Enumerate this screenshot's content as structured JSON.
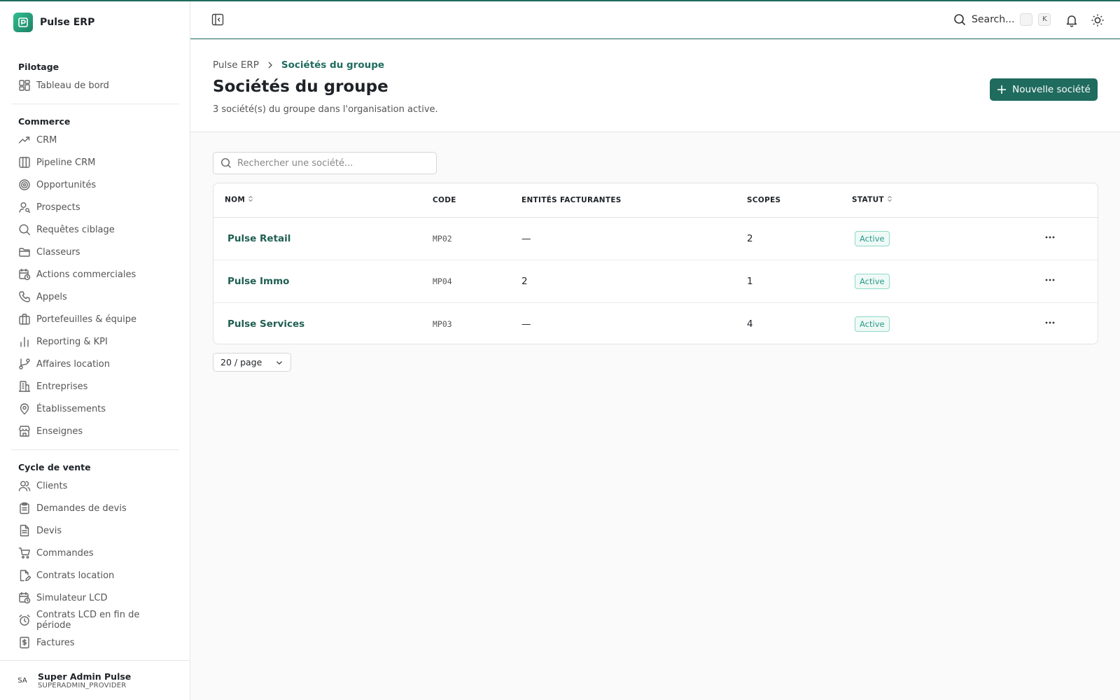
{
  "app": {
    "name": "Pulse ERP"
  },
  "topbar": {
    "search_label": "Search...",
    "shortcut_key": "K"
  },
  "sidebar": {
    "sections": [
      {
        "title": "Pilotage",
        "items": [
          {
            "label": "Tableau de bord",
            "icon": "dashboard-icon"
          }
        ]
      },
      {
        "title": "Commerce",
        "items": [
          {
            "label": "CRM",
            "icon": "trending-up-icon"
          },
          {
            "label": "Pipeline CRM",
            "icon": "kanban-icon"
          },
          {
            "label": "Opportunités",
            "icon": "target-icon"
          },
          {
            "label": "Prospects",
            "icon": "user-search-icon"
          },
          {
            "label": "Requêtes ciblage",
            "icon": "search-icon"
          },
          {
            "label": "Classeurs",
            "icon": "folder-icon"
          },
          {
            "label": "Actions commerciales",
            "icon": "calendar-clock-icon"
          },
          {
            "label": "Appels",
            "icon": "phone-icon"
          },
          {
            "label": "Portefeuilles & équipe",
            "icon": "briefcase-icon"
          },
          {
            "label": "Reporting & KPI",
            "icon": "bar-chart-icon"
          },
          {
            "label": "Affaires location",
            "icon": "git-branch-icon"
          },
          {
            "label": "Entreprises",
            "icon": "building-icon"
          },
          {
            "label": "Établissements",
            "icon": "map-pin-icon"
          },
          {
            "label": "Enseignes",
            "icon": "store-icon"
          }
        ]
      },
      {
        "title": "Cycle de vente",
        "items": [
          {
            "label": "Clients",
            "icon": "users-icon"
          },
          {
            "label": "Demandes de devis",
            "icon": "clipboard-icon"
          },
          {
            "label": "Devis",
            "icon": "file-text-icon"
          },
          {
            "label": "Commandes",
            "icon": "cart-icon"
          },
          {
            "label": "Contrats location",
            "icon": "file-edit-icon"
          },
          {
            "label": "Simulateur LCD",
            "icon": "calendar-clock-icon"
          },
          {
            "label": "Contrats LCD en fin de période",
            "icon": "alarm-clock-icon"
          },
          {
            "label": "Factures",
            "icon": "invoice-dollar-icon"
          }
        ]
      }
    ],
    "user": {
      "initials": "SA",
      "name": "Super Admin Pulse",
      "role": "SUPERADMIN_PROVIDER"
    }
  },
  "header": {
    "breadcrumb": {
      "root": "Pulse ERP",
      "current": "Sociétés du groupe"
    },
    "title": "Sociétés du groupe",
    "subtitle": "3 société(s) du groupe dans l'organisation active.",
    "new_button": "Nouvelle société"
  },
  "search": {
    "placeholder": "Rechercher une société..."
  },
  "table": {
    "columns": {
      "name": "NOM",
      "code": "CODE",
      "entities": "ENTITÉS FACTURANTES",
      "scopes": "SCOPES",
      "status": "STATUT"
    },
    "rows": [
      {
        "name": "Pulse Retail",
        "code": "MP02",
        "entities": "—",
        "scopes": "2",
        "status": "Active"
      },
      {
        "name": "Pulse Immo",
        "code": "MP04",
        "entities": "2",
        "scopes": "1",
        "status": "Active"
      },
      {
        "name": "Pulse Services",
        "code": "MP03",
        "entities": "—",
        "scopes": "4",
        "status": "Active"
      }
    ]
  },
  "pagination": {
    "page_size": "20 / page"
  },
  "colors": {
    "accent": "#1f6b5e",
    "badge_text": "#2a9a88",
    "badge_border": "#8fd8c9"
  }
}
